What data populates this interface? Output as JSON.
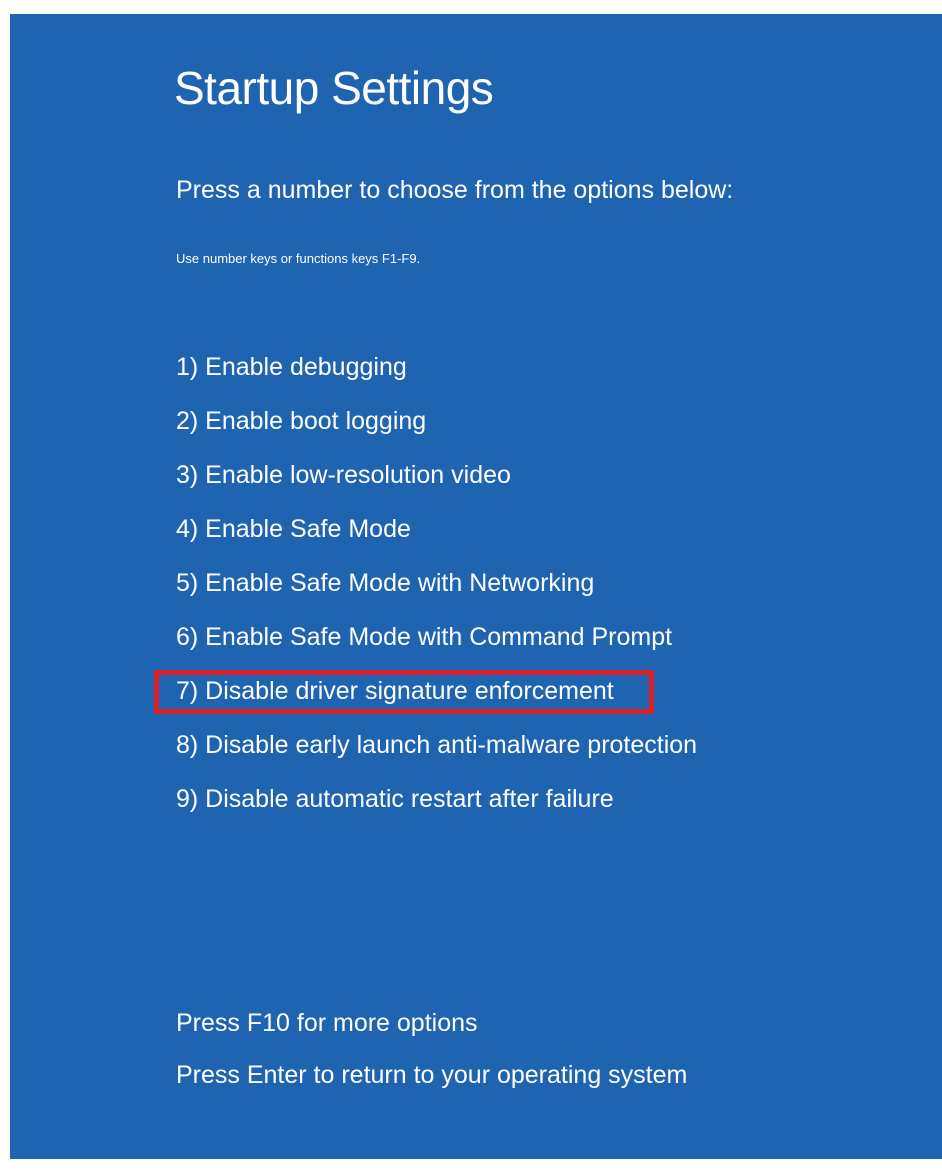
{
  "screen": {
    "title": "Startup Settings",
    "subtitle": "Press a number to choose from the options below:",
    "hint": "Use number keys or functions keys F1-F9.",
    "background_color": "#1f64b1",
    "highlight_color": "#d8202f"
  },
  "options": [
    {
      "label": "1) Enable debugging"
    },
    {
      "label": "2) Enable boot logging"
    },
    {
      "label": "3) Enable low-resolution video"
    },
    {
      "label": "4) Enable Safe Mode"
    },
    {
      "label": "5) Enable Safe Mode with Networking"
    },
    {
      "label": "6) Enable Safe Mode with Command Prompt"
    },
    {
      "label": "7) Disable driver signature enforcement",
      "highlighted": true
    },
    {
      "label": "8) Disable early launch anti-malware protection"
    },
    {
      "label": "9) Disable automatic restart after failure"
    }
  ],
  "footer": {
    "more_options": "Press F10 for more options",
    "return": "Press Enter to return to your operating system"
  }
}
